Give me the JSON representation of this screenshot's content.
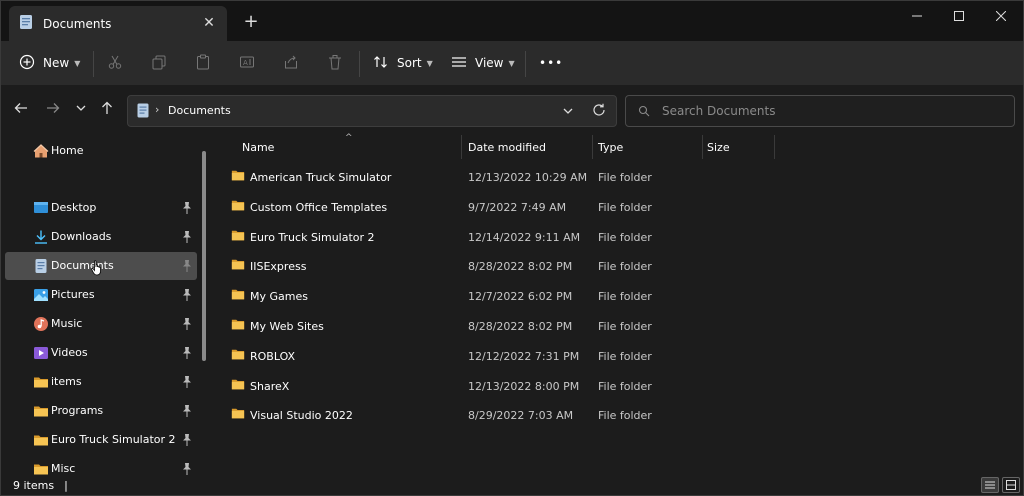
{
  "tab": {
    "title": "Documents"
  },
  "toolbar": {
    "new_label": "New",
    "sort_label": "Sort",
    "view_label": "View",
    "more_label": "•••"
  },
  "address": {
    "path": "Documents"
  },
  "search": {
    "placeholder": "Search Documents"
  },
  "sidebar": {
    "home": "Home",
    "items": [
      {
        "label": "Desktop",
        "icon": "desktop-icon"
      },
      {
        "label": "Downloads",
        "icon": "download-icon"
      },
      {
        "label": "Documents",
        "icon": "document-icon"
      },
      {
        "label": "Pictures",
        "icon": "pictures-icon"
      },
      {
        "label": "Music",
        "icon": "music-icon"
      },
      {
        "label": "Videos",
        "icon": "videos-icon"
      },
      {
        "label": "items",
        "icon": "folder-icon"
      },
      {
        "label": "Programs",
        "icon": "folder-icon"
      },
      {
        "label": "Euro Truck Simulator 2",
        "icon": "folder-icon"
      },
      {
        "label": "Misc",
        "icon": "folder-icon"
      }
    ]
  },
  "columns": {
    "name": "Name",
    "date": "Date modified",
    "type": "Type",
    "size": "Size"
  },
  "files": [
    {
      "name": "American Truck Simulator",
      "date": "12/13/2022 10:29 AM",
      "type": "File folder"
    },
    {
      "name": "Custom Office Templates",
      "date": "9/7/2022 7:49 AM",
      "type": "File folder"
    },
    {
      "name": "Euro Truck Simulator 2",
      "date": "12/14/2022 9:11 AM",
      "type": "File folder"
    },
    {
      "name": "IISExpress",
      "date": "8/28/2022 8:02 PM",
      "type": "File folder"
    },
    {
      "name": "My Games",
      "date": "12/7/2022 6:02 PM",
      "type": "File folder"
    },
    {
      "name": "My Web Sites",
      "date": "8/28/2022 8:02 PM",
      "type": "File folder"
    },
    {
      "name": "ROBLOX",
      "date": "12/12/2022 7:31 PM",
      "type": "File folder"
    },
    {
      "name": "ShareX",
      "date": "12/13/2022 8:00 PM",
      "type": "File folder"
    },
    {
      "name": "Visual Studio 2022",
      "date": "8/29/2022 7:03 AM",
      "type": "File folder"
    }
  ],
  "status": {
    "count": "9 items",
    "cursor": "|"
  },
  "colors": {
    "folder": "#f6c453",
    "accent": "#4cc2ff",
    "selected": "#4d4d4d",
    "background": "#1c1c1c"
  }
}
